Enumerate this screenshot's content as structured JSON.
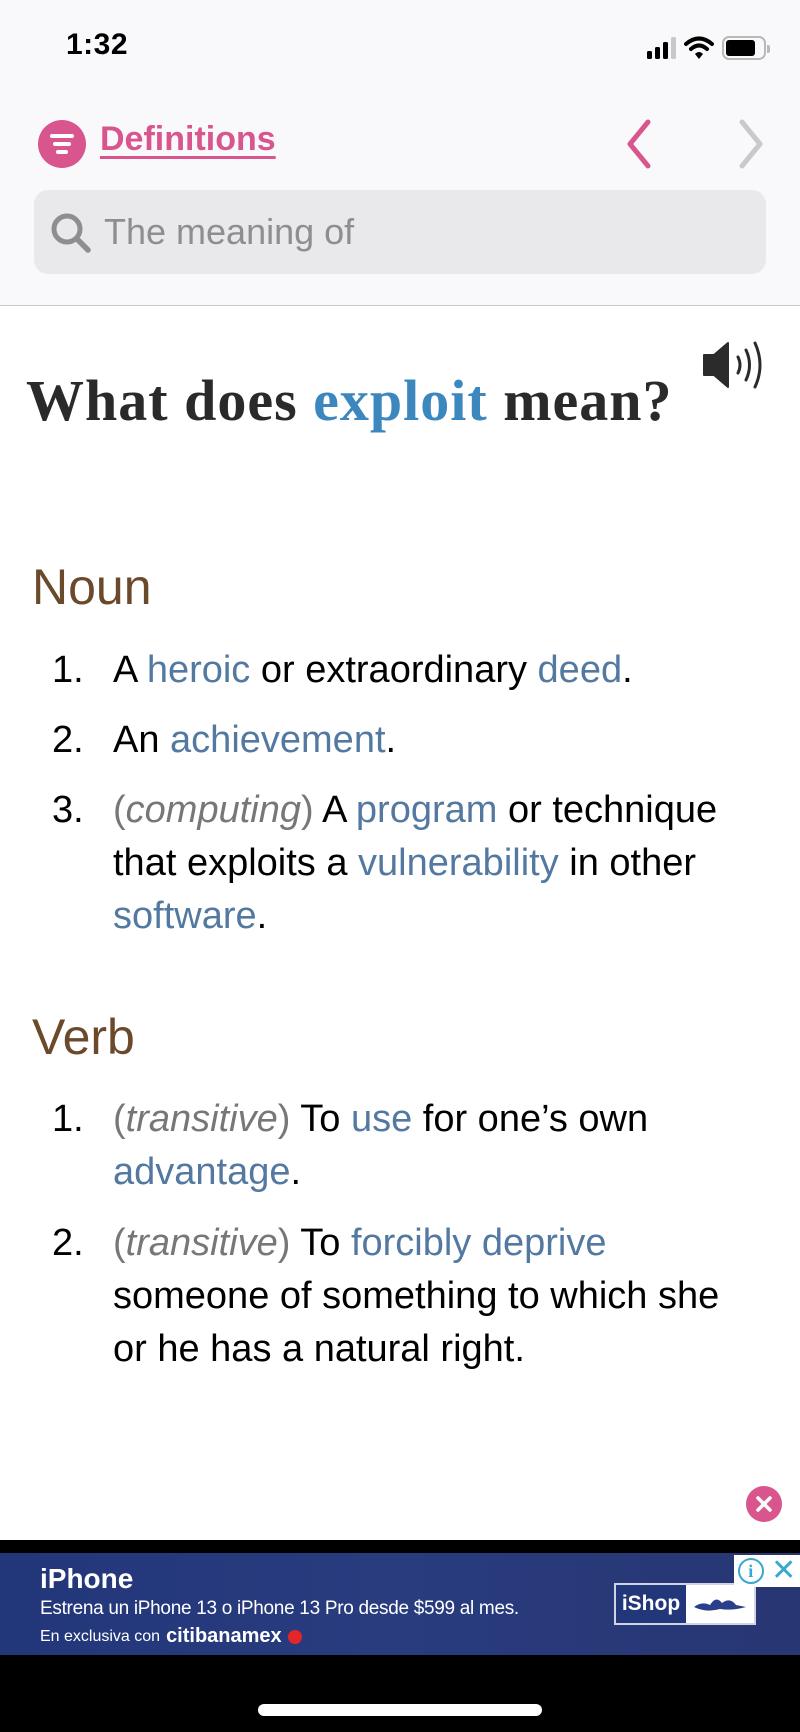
{
  "status_bar": {
    "time": "1:32",
    "icons": [
      "cellular-signal-icon",
      "wifi-icon",
      "battery-icon"
    ],
    "signal_bars": "3 of 4",
    "battery_level": 0.8
  },
  "header": {
    "menu_icon": "list-filter-icon",
    "title": "Definitions",
    "back_icon": "chevron-left-icon",
    "forward_icon": "chevron-right-icon",
    "back_enabled": true,
    "forward_enabled": false,
    "accent_color": "#d9558d"
  },
  "search": {
    "icon": "search-icon",
    "placeholder": "The meaning of",
    "value": ""
  },
  "entry": {
    "speaker_icon": "speaker-icon",
    "headline_prefix": "What does ",
    "word": "exploit",
    "headline_suffix": " mean?",
    "word_color": "#3c87be",
    "sections": [
      {
        "part_of_speech": "Noun",
        "definitions": [
          {
            "number": "1.",
            "parts": [
              {
                "text": "A ",
                "type": "plain"
              },
              {
                "text": "heroic",
                "type": "link"
              },
              {
                "text": " or extraordinary ",
                "type": "plain"
              },
              {
                "text": "deed",
                "type": "link"
              },
              {
                "text": ".",
                "type": "plain"
              }
            ]
          },
          {
            "number": "2.",
            "parts": [
              {
                "text": "An ",
                "type": "plain"
              },
              {
                "text": "achievement",
                "type": "link"
              },
              {
                "text": ".",
                "type": "plain"
              }
            ]
          },
          {
            "number": "3.",
            "qualifier": "computing",
            "parts": [
              {
                "text": " A ",
                "type": "plain"
              },
              {
                "text": "program",
                "type": "link"
              },
              {
                "text": " or technique that exploits a ",
                "type": "plain"
              },
              {
                "text": "vulnerability",
                "type": "link"
              },
              {
                "text": " in other ",
                "type": "plain"
              },
              {
                "text": "software",
                "type": "link"
              },
              {
                "text": ".",
                "type": "plain"
              }
            ]
          }
        ]
      },
      {
        "part_of_speech": "Verb",
        "definitions": [
          {
            "number": "1.",
            "qualifier": "transitive",
            "parts": [
              {
                "text": " To ",
                "type": "plain"
              },
              {
                "text": "use",
                "type": "link"
              },
              {
                "text": " for one’s own ",
                "type": "plain"
              },
              {
                "text": "advantage",
                "type": "link"
              },
              {
                "text": ".",
                "type": "plain"
              }
            ]
          },
          {
            "number": "2.",
            "qualifier": "transitive",
            "parts": [
              {
                "text": " To ",
                "type": "plain"
              },
              {
                "text": "forcibly deprive",
                "type": "link"
              },
              {
                "text": " someone of something to which she or he has a natural right.",
                "type": "plain"
              }
            ]
          }
        ]
      }
    ],
    "heading_color": "#6b4a2b",
    "link_color": "#5379a1"
  },
  "close_button": {
    "icon": "close-icon"
  },
  "ad": {
    "title": "iPhone",
    "text": "Estrena un iPhone 13 o iPhone 13 Pro desde $599 al mes.",
    "sub_prefix": "En exclusiva con",
    "sub_brand": "citibanamex",
    "logo_text": "iShop",
    "info_icon": "info-icon",
    "close_icon": "close-icon",
    "info_glyph": "i",
    "close_glyph": "✕"
  }
}
